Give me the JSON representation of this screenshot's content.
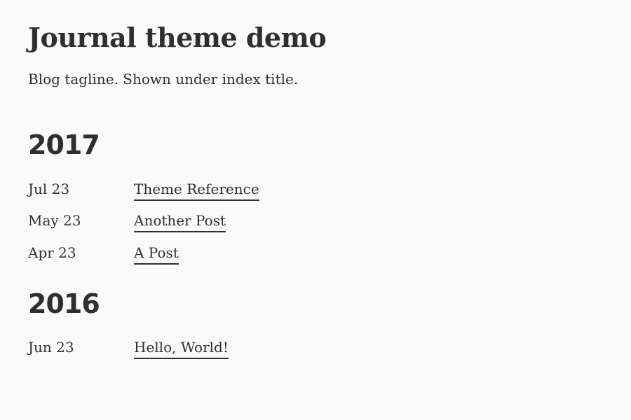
{
  "site": {
    "title": "Journal theme demo",
    "tagline": "Blog tagline. Shown under index title."
  },
  "archive": [
    {
      "year": "2017",
      "posts": [
        {
          "date": "Jul 23",
          "title": "Theme Reference"
        },
        {
          "date": "May 23",
          "title": "Another Post"
        },
        {
          "date": "Apr 23",
          "title": "A Post"
        }
      ]
    },
    {
      "year": "2016",
      "posts": [
        {
          "date": "Jun 23",
          "title": "Hello, World!"
        }
      ]
    }
  ]
}
